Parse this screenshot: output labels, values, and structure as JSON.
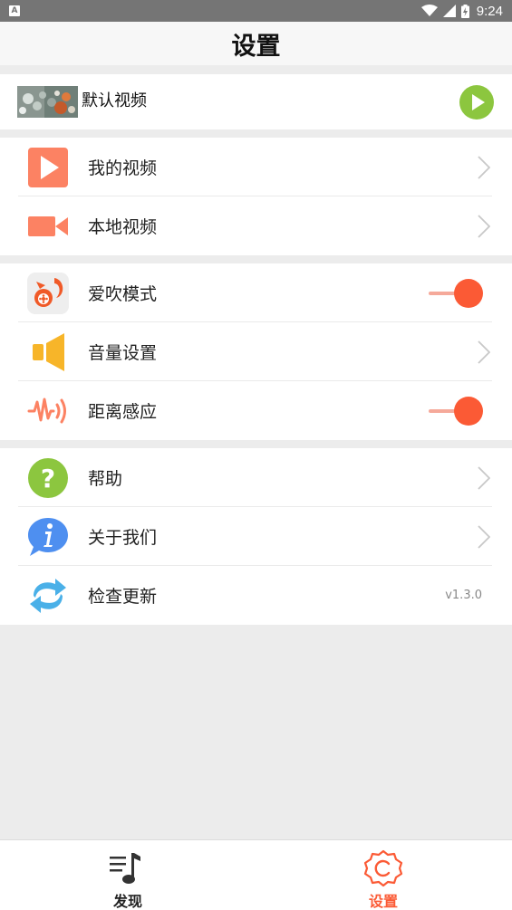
{
  "status_bar": {
    "time": "9:24",
    "notification_icon": "A"
  },
  "title": "设置",
  "default_video": {
    "label": "默认视频"
  },
  "groups": [
    {
      "items": [
        {
          "label": "我的视频"
        },
        {
          "label": "本地视频"
        }
      ]
    },
    {
      "items": [
        {
          "label": "爱吹模式"
        },
        {
          "label": "音量设置"
        },
        {
          "label": "距离感应"
        }
      ]
    },
    {
      "items": [
        {
          "label": "帮助"
        },
        {
          "label": "关于我们"
        },
        {
          "label": "检查更新",
          "value": "v1.3.0"
        }
      ]
    }
  ],
  "toggles": {
    "aichui_mode": true,
    "proximity": true
  },
  "tabs": [
    {
      "label": "发现",
      "icon": "music-note-icon",
      "active": false
    },
    {
      "label": "设置",
      "icon": "settings-gear-icon",
      "active": true
    }
  ],
  "colors": {
    "accent": "#fb5a35",
    "green": "#8cc63f",
    "orange": "#fc8263",
    "yellow": "#f7b529",
    "blue": "#4e8ff0"
  }
}
